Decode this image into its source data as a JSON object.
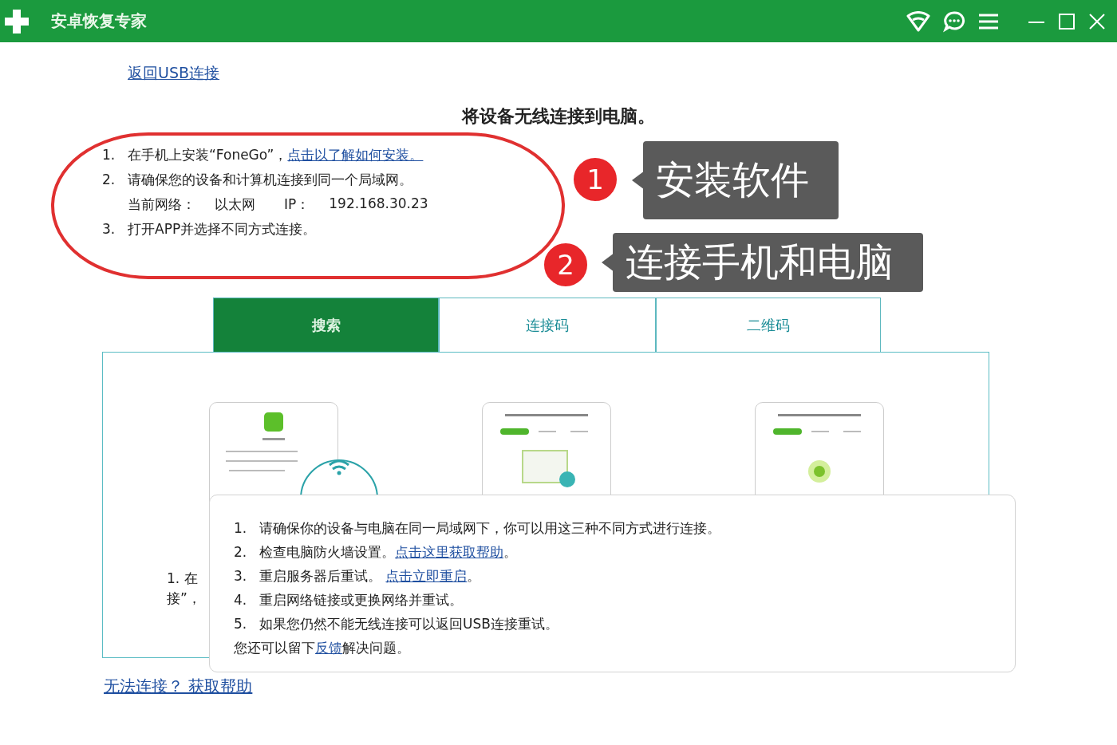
{
  "window": {
    "title": "安卓恢复专家"
  },
  "back_link": "返回USB连接",
  "heading": "将设备无线连接到电脑。",
  "steps": [
    {
      "kind": "step",
      "number": "1.",
      "text": "在手机上安装“FoneGo”，",
      "link": "点击以了解如何安装。"
    },
    {
      "kind": "step",
      "number": "2.",
      "text": "请确保您的设备和计算机连接到同一个局域网。"
    },
    {
      "kind": "network",
      "label": "当前网络：",
      "network": "以太网",
      "ip_label": "IP：",
      "ip": "192.168.30.23"
    },
    {
      "kind": "step",
      "number": "3.",
      "text": "打开APP并选择不同方式连接。"
    }
  ],
  "tabs": [
    {
      "label": "搜索",
      "selected": true
    },
    {
      "label": "连接码",
      "selected": false
    },
    {
      "label": "二维码",
      "selected": false
    }
  ],
  "panel": {
    "partial_lines": [
      "1.  在",
      "接”，"
    ]
  },
  "help_popup": {
    "lines": [
      {
        "number": "1.",
        "text": "请确保你的设备与电脑在同一局域网下，你可以用这三种不同方式进行连接。"
      },
      {
        "number": "2.",
        "text": "检查电脑防火墙设置。",
        "link": "点击这里获取帮助",
        "after": "。"
      },
      {
        "number": "3.",
        "text": "重启服务器后重试。 ",
        "link": "点击立即重启",
        "after": "。"
      },
      {
        "number": "4.",
        "text": "重启网络链接或更换网络并重试。"
      },
      {
        "number": "5.",
        "text": "如果您仍然不能无线连接可以返回USB连接重试。"
      }
    ],
    "footer": {
      "before": "您还可以留下",
      "link": "反馈",
      "after": "解决问题。"
    }
  },
  "help_link": "无法连接？ 获取帮助",
  "annotations": [
    {
      "number": "1",
      "text": "安装软件"
    },
    {
      "number": "2",
      "text": "连接手机和电脑"
    }
  ]
}
